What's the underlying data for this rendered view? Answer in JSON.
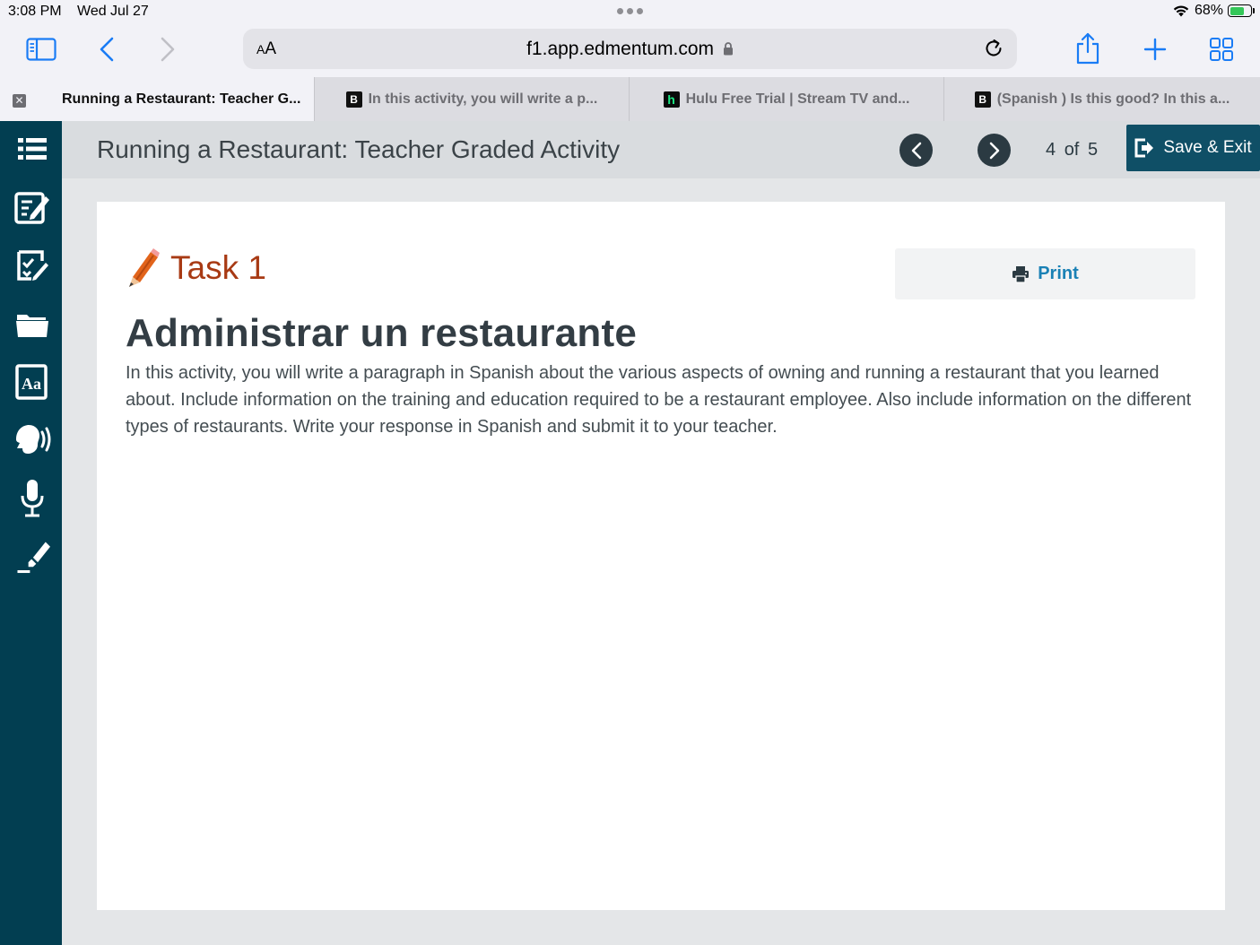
{
  "status_bar": {
    "time": "3:08 PM",
    "date": "Wed Jul 27",
    "battery": "68%",
    "battery_level": 0.68
  },
  "browser": {
    "aa_label": "AA",
    "url": "f1.app.edmentum.com",
    "accent_color": "#1a7cf5",
    "tabs": [
      {
        "title": "Running a Restaurant: Teacher G...",
        "active": true
      },
      {
        "title": "In this activity, you will write a p...",
        "active": false,
        "favicon": "B"
      },
      {
        "title": "Hulu Free Trial | Stream TV and...",
        "active": false,
        "favicon": "h"
      },
      {
        "title": "(Spanish ) Is this good? In this a...",
        "active": false,
        "favicon": "B"
      }
    ]
  },
  "sidebar": {
    "color": "#023e51",
    "items": [
      "list-icon",
      "notepad-icon",
      "checklist-icon",
      "folder-icon",
      "dictionary-icon",
      "speak-icon",
      "microphone-icon",
      "highlighter-icon"
    ],
    "dictionary_glyph": "Aa"
  },
  "header": {
    "title": "Running a Restaurant: Teacher Graded Activity",
    "page_current": "4",
    "page_of": "of",
    "page_total": "5",
    "save_exit_label": "Save & Exit"
  },
  "content": {
    "task_label": "Task 1",
    "print_label": "Print",
    "heading": "Administrar un restaurante",
    "paragraph": "In this activity, you will write a paragraph in Spanish about the various aspects of owning and running a restaurant that you learned about. Include information on the training and education required to be a restaurant employee. Also include information on the different types of restaurants. Write your response in Spanish and submit it to your teacher."
  }
}
